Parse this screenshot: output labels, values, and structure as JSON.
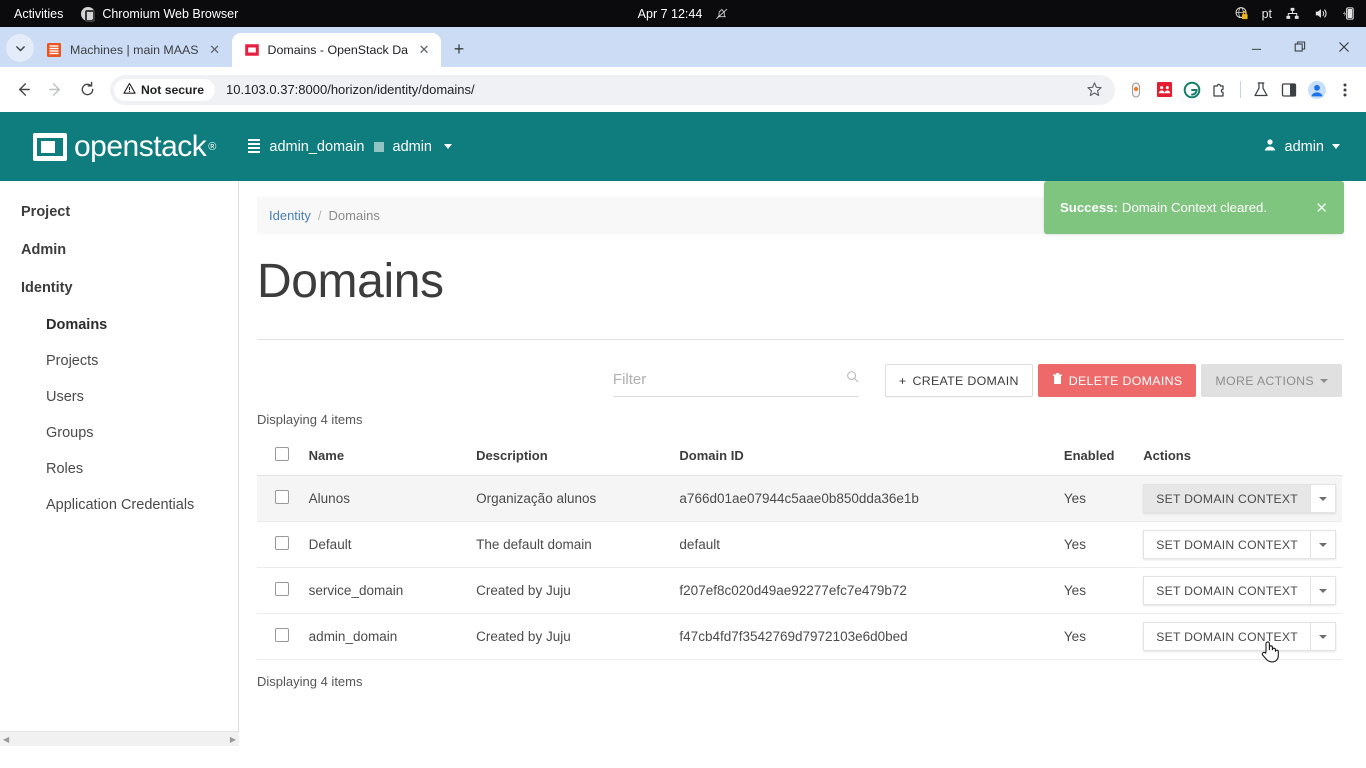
{
  "gnome": {
    "activities": "Activities",
    "app_name": "Chromium Web Browser",
    "clock": "Apr 7  12:44",
    "notifications_icon": "bell-muted-icon",
    "tray": {
      "network_secure_icon": "network-secure-icon",
      "keyboard_layout": "pt",
      "wired_icon": "wired-network-icon",
      "volume_icon": "volume-icon",
      "battery_icon": "battery-charging-icon"
    }
  },
  "browser": {
    "tablist_icon": "chevron-down-icon",
    "tabs": [
      {
        "title": "Machines | main MAAS",
        "favicon": "maas-favicon",
        "active": false,
        "close_icon": "close-icon"
      },
      {
        "title": "Domains - OpenStack Da",
        "favicon": "openstack-favicon",
        "active": true,
        "close_icon": "close-icon"
      }
    ],
    "new_tab_label": "+",
    "window_controls": {
      "minimize": "—",
      "maximize": "❐",
      "close": "✕"
    },
    "nav": {
      "back_icon": "arrow-left-icon",
      "forward_icon": "arrow-right-icon",
      "reload_icon": "reload-icon"
    },
    "omnibox": {
      "security_label": "Not secure",
      "security_icon": "warning-triangle-icon",
      "url": "10.103.0.37:8000/horizon/identity/domains/",
      "bookmark_icon": "star-icon"
    },
    "extensions": [
      "pill-extension-icon",
      "red-square-extension-icon",
      "grammarly-icon",
      "puzzle-extensions-icon",
      "flask-labs-icon",
      "side-panel-icon",
      "profile-avatar-icon",
      "three-dot-menu-icon"
    ]
  },
  "openstack": {
    "brand": "openstack",
    "brand_mark": "®",
    "context": {
      "domain_icon": "list-icon",
      "domain": "admin_domain",
      "project_icon": "square-icon",
      "project": "admin",
      "caret_icon": "caret-down-icon"
    },
    "user": {
      "avatar_icon": "user-icon",
      "name": "admin",
      "caret_icon": "caret-down-icon"
    },
    "accent_color": "#0f7d7d",
    "danger_color": "#ee6a6a",
    "success_color": "#7fc47f"
  },
  "sidebar": {
    "groups": [
      {
        "label": "Project",
        "items": []
      },
      {
        "label": "Admin",
        "items": []
      },
      {
        "label": "Identity",
        "items": [
          {
            "label": "Domains",
            "active": true
          },
          {
            "label": "Projects",
            "active": false
          },
          {
            "label": "Users",
            "active": false
          },
          {
            "label": "Groups",
            "active": false
          },
          {
            "label": "Roles",
            "active": false
          },
          {
            "label": "Application Credentials",
            "active": false
          }
        ]
      }
    ],
    "scroll_left_icon": "triangle-left-icon",
    "scroll_right_icon": "triangle-right-icon"
  },
  "toast": {
    "prefix": "Success:",
    "message": "Domain Context cleared.",
    "close_icon": "close-icon"
  },
  "breadcrumb": {
    "root": "Identity",
    "separator": "/",
    "current": "Domains"
  },
  "page": {
    "title": "Domains"
  },
  "filter": {
    "placeholder": "Filter",
    "value": "",
    "search_icon": "search-icon"
  },
  "buttons": {
    "create": {
      "label": "CREATE DOMAIN",
      "icon": "plus-icon"
    },
    "delete": {
      "label": "DELETE DOMAINS",
      "icon": "trash-icon"
    },
    "more": {
      "label": "MORE ACTIONS",
      "icon": "caret-down-icon"
    }
  },
  "table": {
    "count_top": "Displaying 4 items",
    "count_bottom": "Displaying 4 items",
    "select_all_checkbox": false,
    "columns": [
      "Name",
      "Description",
      "Domain ID",
      "Enabled",
      "Actions"
    ],
    "row_action_label": "SET DOMAIN CONTEXT",
    "row_action_caret": "caret-down-icon",
    "rows": [
      {
        "checked": false,
        "name": "Alunos",
        "description": "Organização alunos",
        "domain_id": "a766d01ae07944c5aae0b850dda36e1b",
        "enabled": "Yes",
        "hovered": true
      },
      {
        "checked": false,
        "name": "Default",
        "description": "The default domain",
        "domain_id": "default",
        "enabled": "Yes",
        "hovered": false
      },
      {
        "checked": false,
        "name": "service_domain",
        "description": "Created by Juju",
        "domain_id": "f207ef8c020d49ae92277efc7e479b72",
        "enabled": "Yes",
        "hovered": false
      },
      {
        "checked": false,
        "name": "admin_domain",
        "description": "Created by Juju",
        "domain_id": "f47cb4fd7f3542769d7972103e6d0bed",
        "enabled": "Yes",
        "hovered": false
      }
    ]
  }
}
